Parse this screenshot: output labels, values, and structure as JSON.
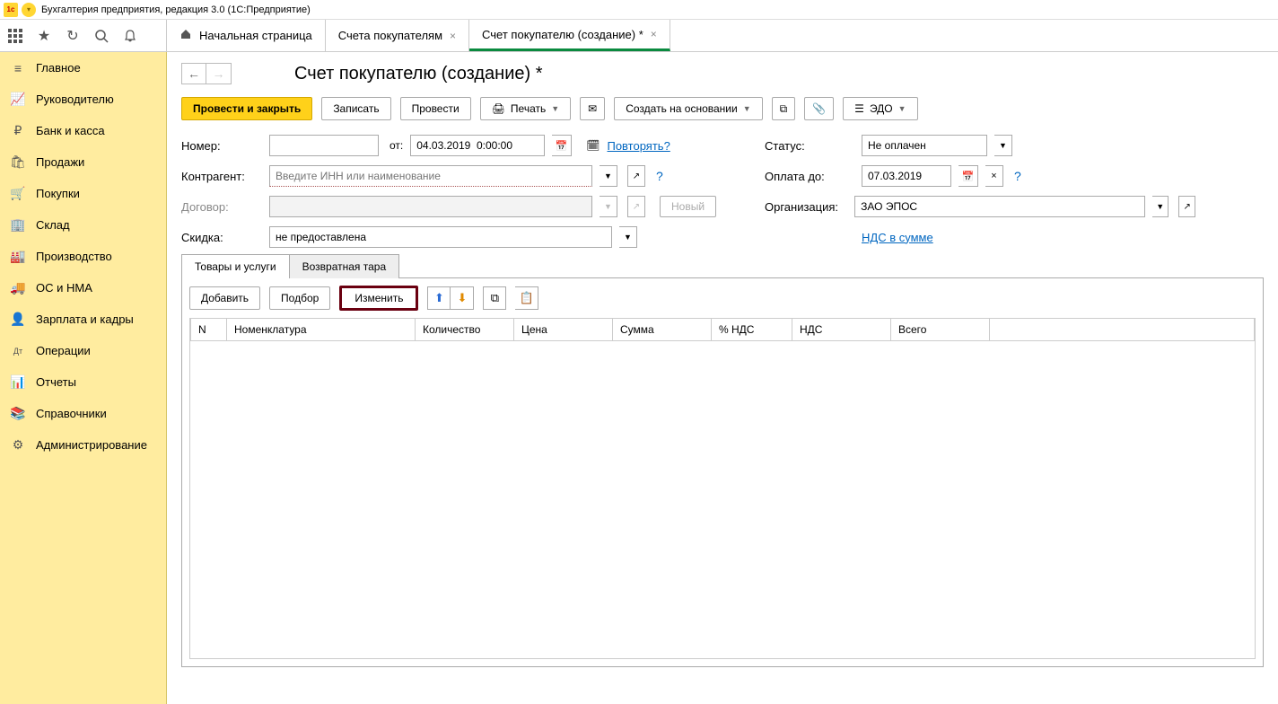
{
  "window": {
    "title": "Бухгалтерия предприятия, редакция 3.0   (1С:Предприятие)"
  },
  "top_icons": {
    "grid": "grid",
    "star": "★",
    "history": "↻",
    "search": "🔍",
    "bell": "🔔"
  },
  "tabs": {
    "home": "Начальная страница",
    "items": [
      {
        "label": "Счета покупателям"
      },
      {
        "label": "Счет покупателю (создание) *",
        "active": true
      }
    ]
  },
  "sidebar": [
    {
      "icon": "≡",
      "label": "Главное"
    },
    {
      "icon": "📈",
      "label": "Руководителю"
    },
    {
      "icon": "₽",
      "label": "Банк и касса"
    },
    {
      "icon": "🛍",
      "label": "Продажи"
    },
    {
      "icon": "🛒",
      "label": "Покупки"
    },
    {
      "icon": "🏢",
      "label": "Склад"
    },
    {
      "icon": "🏭",
      "label": "Производство"
    },
    {
      "icon": "🚚",
      "label": "ОС и НМА"
    },
    {
      "icon": "👤",
      "label": "Зарплата и кадры"
    },
    {
      "icon": "Дт",
      "label": "Операции"
    },
    {
      "icon": "📊",
      "label": "Отчеты"
    },
    {
      "icon": "📚",
      "label": "Справочники"
    },
    {
      "icon": "⚙",
      "label": "Администрирование"
    }
  ],
  "page": {
    "title": "Счет покупателю (создание) *"
  },
  "cmd": {
    "post_close": "Провести и закрыть",
    "save": "Записать",
    "post": "Провести",
    "print": "Печать",
    "create_based": "Создать на основании",
    "edo": "ЭДО"
  },
  "form": {
    "number_label": "Номер:",
    "number": "",
    "from_label": "от:",
    "date": "04.03.2019  0:00:00",
    "repeat": "Повторять?",
    "status_label": "Статус:",
    "status": "Не оплачен",
    "counterparty_label": "Контрагент:",
    "counterparty_placeholder": "Введите ИНН или наименование",
    "pay_until_label": "Оплата до:",
    "pay_until": "07.03.2019",
    "contract_label": "Договор:",
    "contract": "",
    "new_btn": "Новый",
    "org_label": "Организация:",
    "org": "ЗАО ЭПОС",
    "discount_label": "Скидка:",
    "discount": "не предоставлена",
    "vat_link": "НДС в сумме"
  },
  "sectabs": {
    "goods": "Товары и услуги",
    "returnable": "Возвратная тара"
  },
  "rowbar": {
    "add": "Добавить",
    "pick": "Подбор",
    "change": "Изменить"
  },
  "columns": [
    "N",
    "Номенклатура",
    "Количество",
    "Цена",
    "Сумма",
    "% НДС",
    "НДС",
    "Всего"
  ],
  "rows": []
}
